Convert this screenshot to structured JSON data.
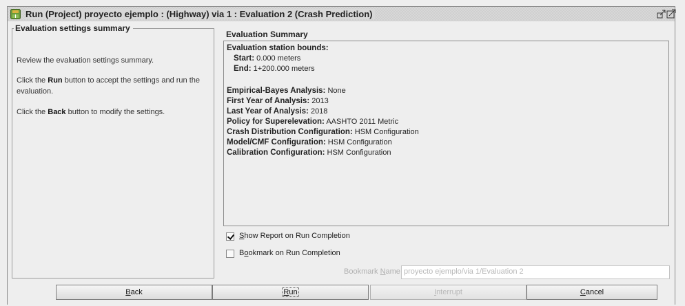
{
  "window": {
    "title": "Run (Project) proyecto ejemplo : (Highway) via 1 : Evaluation 2 (Crash Prediction)",
    "icons": {
      "app": "ihsdm-app-icon",
      "restore": "restore-window-icon",
      "maximize": "maximize-window-icon"
    }
  },
  "left_panel": {
    "title": "Evaluation settings summary",
    "instructions": {
      "line1": "Review the evaluation settings summary.",
      "line2_pre": "Click the ",
      "line2_bold": "Run",
      "line2_post": " button to accept the settings and run the evaluation.",
      "line3_pre": "Click the ",
      "line3_bold": "Back",
      "line3_post": " button to modify the settings."
    }
  },
  "summary": {
    "heading": "Evaluation Summary",
    "station_bounds_label": "Evaluation station bounds:",
    "start_label": "Start:",
    "start_value": " 0.000 meters",
    "end_label": "End:",
    "end_value": " 1+200.000 meters",
    "items": [
      {
        "key": "Empirical-Bayes Analysis:",
        "value": " None"
      },
      {
        "key": "First Year of Analysis:",
        "value": " 2013"
      },
      {
        "key": "Last Year of Analysis:",
        "value": " 2018"
      },
      {
        "key": "Policy for Superelevation:",
        "value": " AASHTO 2011 Metric"
      },
      {
        "key": "Crash Distribution Configuration:",
        "value": " HSM Configuration"
      },
      {
        "key": "Model/CMF Configuration:",
        "value": " HSM Configuration"
      },
      {
        "key": "Calibration Configuration:",
        "value": " HSM Configuration"
      }
    ]
  },
  "options": {
    "show_report": {
      "mnemonic": "S",
      "rest": "how Report on Run Completion",
      "checked": true
    },
    "bookmark": {
      "pre": "B",
      "mnemonic": "o",
      "rest": "okmark on Run Completion",
      "checked": false
    }
  },
  "bookmark_name": {
    "label_pre": "Bookmark ",
    "label_mnemonic": "N",
    "label_post": "ame :",
    "value": "proyecto ejemplo/via 1/Evaluation 2"
  },
  "buttons": {
    "back": {
      "mnemonic": "B",
      "rest": "ack"
    },
    "run": {
      "mnemonic": "R",
      "rest": "un"
    },
    "interrupt": {
      "mnemonic": "I",
      "rest": "nterrupt"
    },
    "cancel": {
      "mnemonic": "C",
      "rest": "ancel"
    }
  }
}
